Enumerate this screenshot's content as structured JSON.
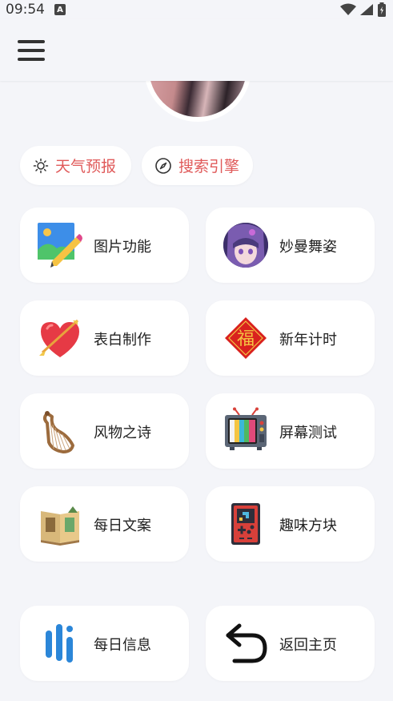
{
  "status_bar": {
    "time": "09:54",
    "notif_letter": "A"
  },
  "chips": [
    {
      "label": "天气预报",
      "icon": "sun-icon"
    },
    {
      "label": "搜索引擎",
      "icon": "compass-icon"
    }
  ],
  "cards": [
    {
      "label": "图片功能",
      "icon": "image-edit-icon"
    },
    {
      "label": "妙曼舞姿",
      "icon": "anime-avatar-icon"
    },
    {
      "label": "表白制作",
      "icon": "heart-arrow-icon"
    },
    {
      "label": "新年计时",
      "icon": "fu-diamond-icon"
    },
    {
      "label": "风物之诗",
      "icon": "lyre-icon"
    },
    {
      "label": "屏幕测试",
      "icon": "retro-tv-icon"
    },
    {
      "label": "每日文案",
      "icon": "open-book-icon"
    },
    {
      "label": "趣味方块",
      "icon": "game-console-icon"
    },
    {
      "label": "每日信息",
      "icon": "bars-logo-icon"
    },
    {
      "label": "返回主页",
      "icon": "return-arrow-icon"
    }
  ],
  "colors": {
    "accent": "#e05a5a",
    "background": "#f4f5f9",
    "card": "#ffffff"
  }
}
